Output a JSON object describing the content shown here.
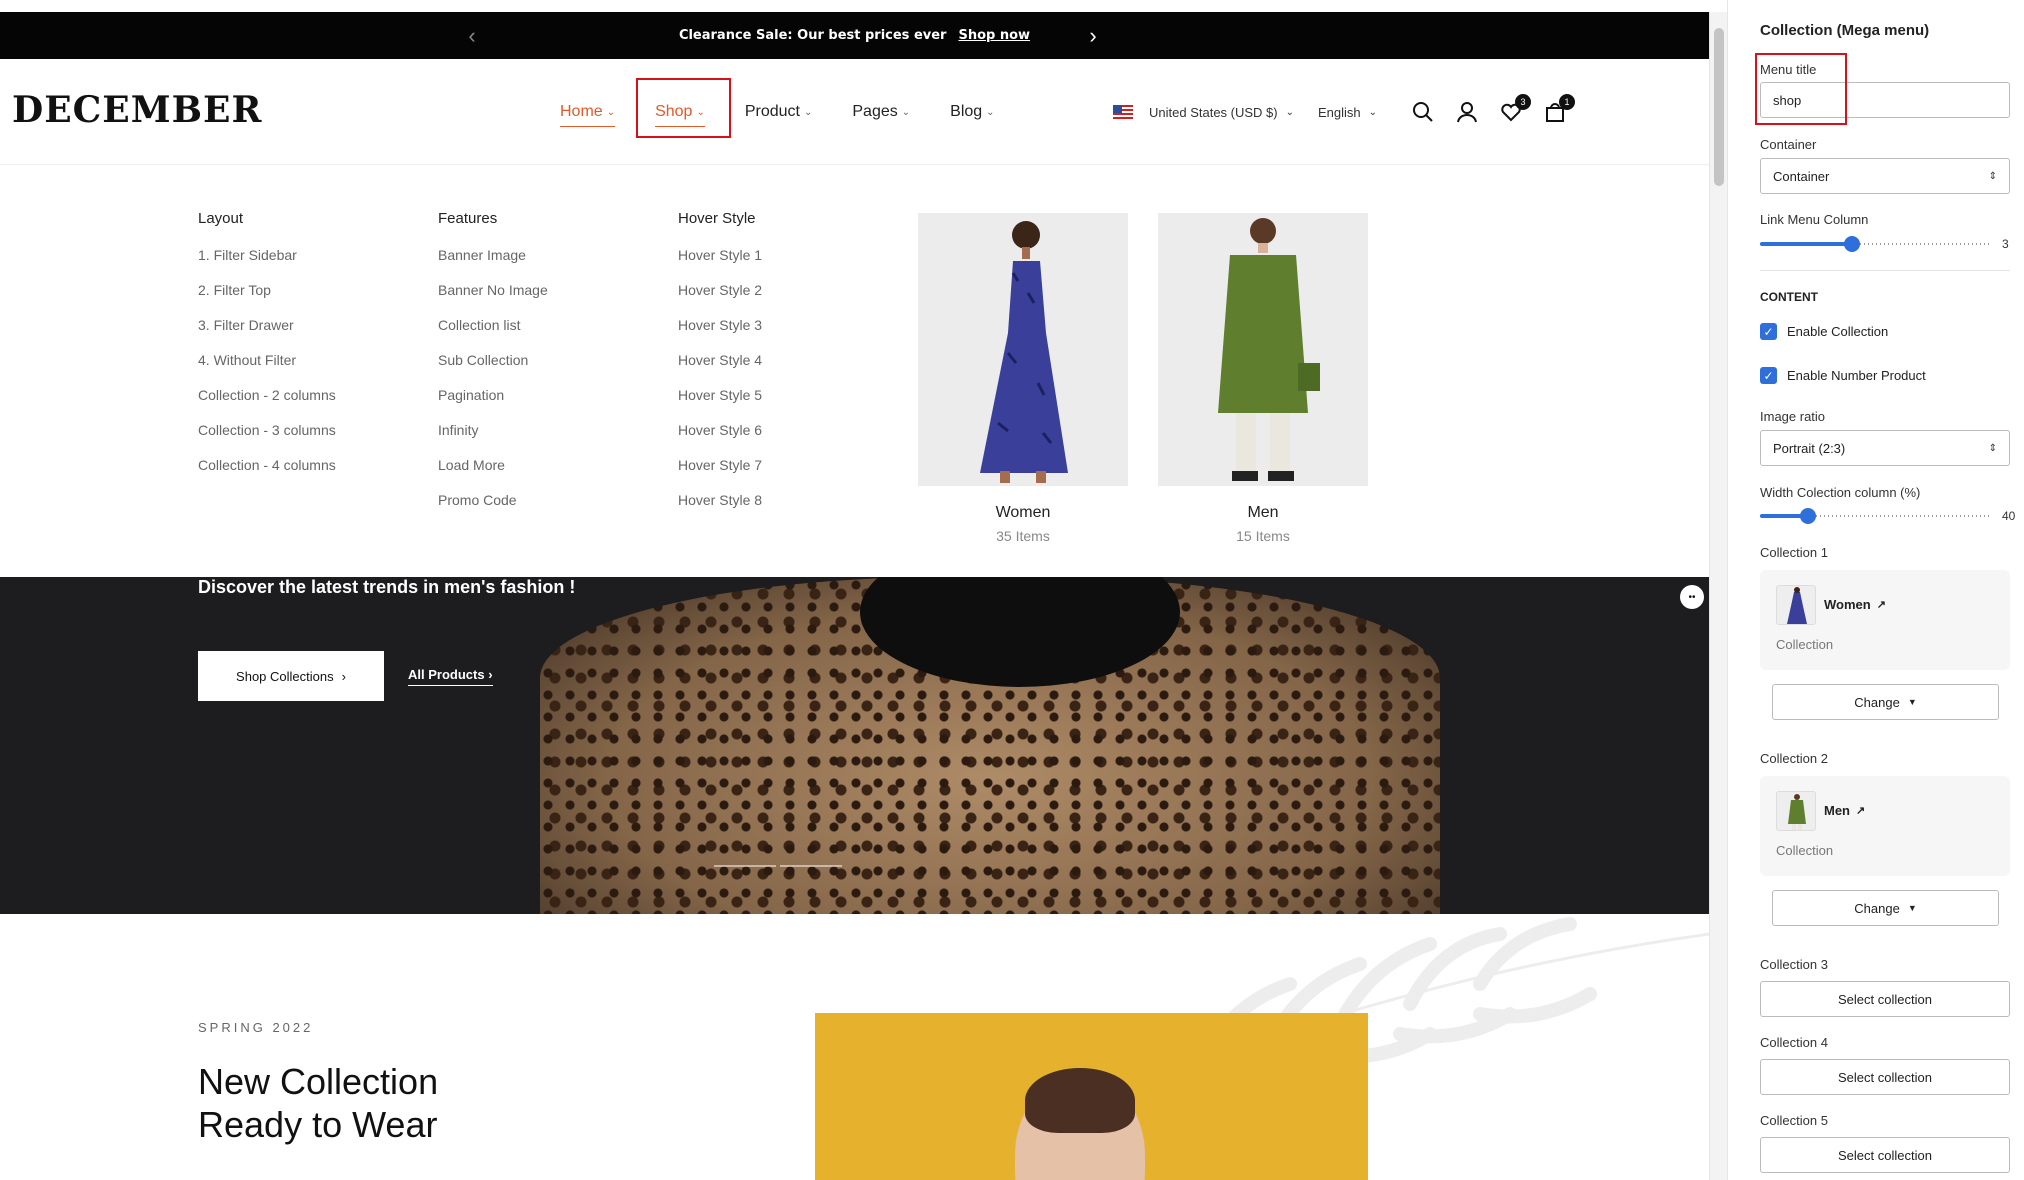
{
  "announcement": {
    "text": "Clearance Sale: Our best prices ever",
    "link": "Shop now"
  },
  "header": {
    "logo": "DECEMBER",
    "nav": [
      {
        "label": "Home",
        "active": true
      },
      {
        "label": "Shop",
        "active": true
      },
      {
        "label": "Product",
        "active": false
      },
      {
        "label": "Pages",
        "active": false
      },
      {
        "label": "Blog",
        "active": false
      }
    ],
    "currency": "United States (USD $)",
    "language": "English",
    "wishlist_count": "3",
    "cart_count": "1"
  },
  "mega_menu": {
    "columns": [
      {
        "heading": "Layout",
        "links": [
          "1. Filter Sidebar",
          "2. Filter Top",
          "3. Filter Drawer",
          "4. Without Filter",
          "Collection - 2 columns",
          "Collection - 3 columns",
          "Collection - 4 columns"
        ]
      },
      {
        "heading": "Features",
        "links": [
          "Banner Image",
          "Banner No Image",
          "Collection list",
          "Sub Collection",
          "Pagination",
          "Infinity",
          "Load More",
          "Promo Code"
        ]
      },
      {
        "heading": "Hover Style",
        "links": [
          "Hover Style 1",
          "Hover Style 2",
          "Hover Style 3",
          "Hover Style 4",
          "Hover Style 5",
          "Hover Style 6",
          "Hover Style 7",
          "Hover Style 8"
        ]
      }
    ],
    "collections": [
      {
        "title": "Women",
        "count": "35 Items"
      },
      {
        "title": "Men",
        "count": "15 Items"
      }
    ]
  },
  "hero": {
    "headline": "Discover the latest trends in men's fashion !",
    "primary_button": "Shop Collections",
    "secondary_link": "All Products",
    "slides": 2
  },
  "lower": {
    "eyebrow": "SPRING 2022",
    "title_line1": "New Collection",
    "title_line2": "Ready to Wear"
  },
  "panel": {
    "title": "Collection (Mega menu)",
    "menu_title_label": "Menu title",
    "menu_title_value": "shop",
    "container_label": "Container",
    "container_value": "Container",
    "link_menu_column_label": "Link Menu Column",
    "link_menu_column_value": "3",
    "content_heading": "CONTENT",
    "enable_collection": "Enable Collection",
    "enable_number_product": "Enable Number Product",
    "image_ratio_label": "Image ratio",
    "image_ratio_value": "Portrait (2:3)",
    "width_label": "Width Colection column (%)",
    "width_value": "40",
    "collection1_label": "Collection 1",
    "collection1_name": "Women",
    "collection1_type": "Collection",
    "collection2_label": "Collection 2",
    "collection2_name": "Men",
    "collection2_type": "Collection",
    "change_label": "Change",
    "collection3_label": "Collection 3",
    "collection4_label": "Collection 4",
    "collection5_label": "Collection 5",
    "select_collection": "Select collection"
  },
  "colors": {
    "accent": "#e05a2b",
    "highlight_box": "#d8101a",
    "control_blue": "#2f6fdb",
    "announcement_bg": "#050505"
  }
}
